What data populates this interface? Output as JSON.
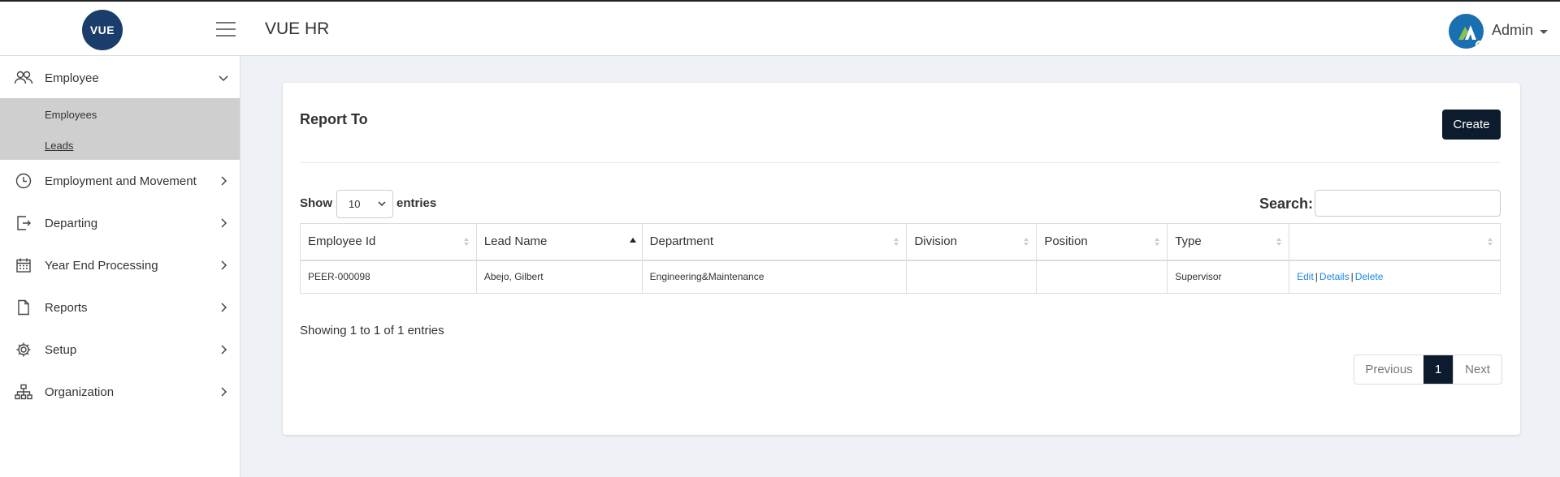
{
  "app": {
    "logo_text": "VUE",
    "title": "VUE HR",
    "user_name": "Admin"
  },
  "sidebar": {
    "items": [
      {
        "label": "Employee",
        "icon": "users-icon",
        "expanded": true
      },
      {
        "label": "Employment and Movement",
        "icon": "clock-icon"
      },
      {
        "label": "Departing",
        "icon": "exit-icon"
      },
      {
        "label": "Year End Processing",
        "icon": "calendar-icon"
      },
      {
        "label": "Reports",
        "icon": "file-icon"
      },
      {
        "label": "Setup",
        "icon": "gear-icon"
      },
      {
        "label": "Organization",
        "icon": "org-chart-icon"
      }
    ],
    "submenu": [
      {
        "label": "Employees"
      },
      {
        "label": "Leads",
        "active": true
      }
    ]
  },
  "page": {
    "title": "Report To",
    "create_label": "Create",
    "show_label": "Show",
    "entries_value": "10",
    "entries_label": "entries",
    "search_label": "Search:",
    "search_value": ""
  },
  "table": {
    "columns": [
      "Employee Id",
      "Lead Name",
      "Department",
      "Division",
      "Position",
      "Type",
      ""
    ],
    "rows": [
      {
        "employee_id": "PEER-000098",
        "lead_name": "Abejo, Gilbert",
        "department": "Engineering&Maintenance",
        "division": "",
        "position": "",
        "type": "Supervisor",
        "actions": [
          "Edit",
          "Details",
          "Delete"
        ],
        "separator": "|"
      }
    ]
  },
  "footer": {
    "info": "Showing 1 to 1 of 1 entries",
    "prev_label": "Previous",
    "page": "1",
    "next_label": "Next"
  },
  "colors": {
    "primary_dark": "#0d1b2e",
    "link": "#1e88e5",
    "logo_bg": "#1a3d6b",
    "submenu_bg": "#cfcfcf",
    "page_bg": "#eef1f5"
  }
}
